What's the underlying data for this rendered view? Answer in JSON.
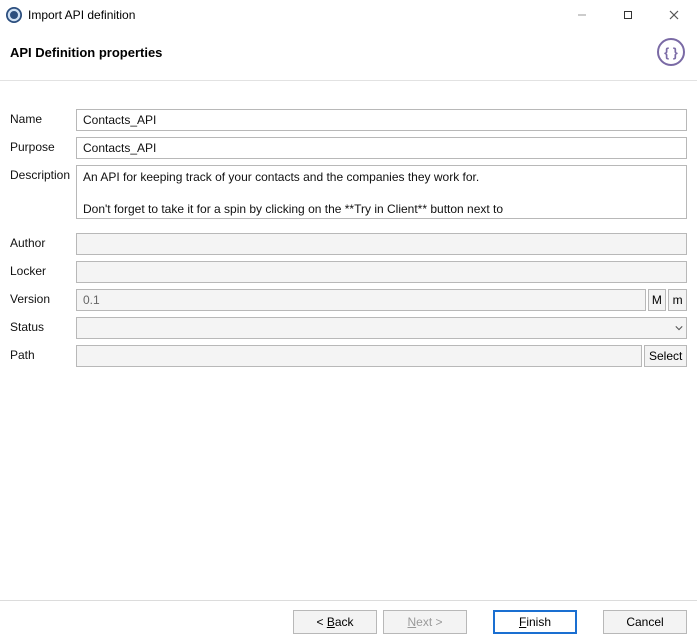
{
  "window": {
    "title": "Import API definition"
  },
  "header": {
    "title": "API Definition properties",
    "icon_glyph": "{ }"
  },
  "labels": {
    "name": "Name",
    "purpose": "Purpose",
    "description": "Description",
    "author": "Author",
    "locker": "Locker",
    "version": "Version",
    "status": "Status",
    "path": "Path"
  },
  "values": {
    "name": "Contacts_API",
    "purpose": "Contacts_API",
    "description": "An API for keeping track of your contacts and the companies they work for.\n\nDon't forget to take it for a spin by clicking on the **Try in Client** button next to",
    "author": "",
    "locker": "",
    "version": "0.1",
    "status": "",
    "path": ""
  },
  "buttons": {
    "major": "M",
    "minor": "m",
    "select": "Select",
    "back_prefix": "< ",
    "back_label": "Back",
    "next_label": "Next",
    "next_suffix": " >",
    "finish_label": "Finish",
    "cancel": "Cancel"
  }
}
